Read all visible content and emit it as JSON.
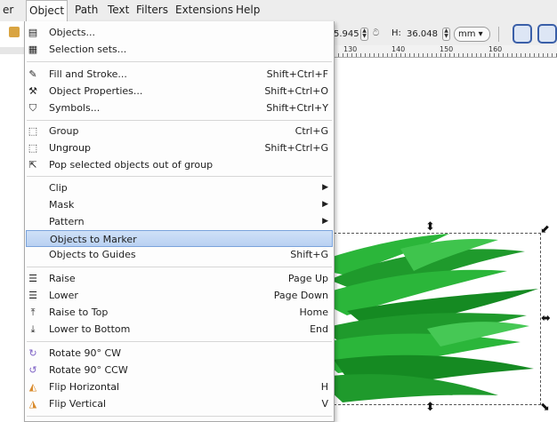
{
  "menubar": {
    "items": [
      {
        "label": "er"
      },
      {
        "label": "Object"
      },
      {
        "label": "Path"
      },
      {
        "label": "Text"
      },
      {
        "label": "Filters"
      },
      {
        "label": "Extensions"
      },
      {
        "label": "Help"
      }
    ]
  },
  "toolbar": {
    "x_value": "5.945",
    "h_label": "H:",
    "h_value": "36.048",
    "unit": "mm"
  },
  "ruler": {
    "labels": [
      "130",
      "140",
      "150",
      "160"
    ]
  },
  "menu": {
    "items": [
      {
        "label": "Objects...",
        "shortcut": "",
        "icon": "objects-icon"
      },
      {
        "label": "Selection sets...",
        "shortcut": "",
        "icon": "selection-sets-icon"
      },
      {
        "label": "Fill and Stroke...",
        "shortcut": "Shift+Ctrl+F",
        "icon": "fill-stroke-icon"
      },
      {
        "label": "Object Properties...",
        "shortcut": "Shift+Ctrl+O",
        "icon": "object-properties-icon"
      },
      {
        "label": "Symbols...",
        "shortcut": "Shift+Ctrl+Y",
        "icon": "symbols-icon"
      },
      {
        "label": "Group",
        "shortcut": "Ctrl+G",
        "icon": "group-icon"
      },
      {
        "label": "Ungroup",
        "shortcut": "Shift+Ctrl+G",
        "icon": "ungroup-icon"
      },
      {
        "label": "Pop selected objects out of group",
        "shortcut": "",
        "icon": "pop-out-icon"
      },
      {
        "label": "Clip",
        "shortcut": "",
        "icon": ""
      },
      {
        "label": "Mask",
        "shortcut": "",
        "icon": ""
      },
      {
        "label": "Pattern",
        "shortcut": "",
        "icon": ""
      },
      {
        "label": "Objects to Marker",
        "shortcut": "",
        "icon": ""
      },
      {
        "label": "Objects to Guides",
        "shortcut": "Shift+G",
        "icon": ""
      },
      {
        "label": "Raise",
        "shortcut": "Page Up",
        "icon": "raise-icon"
      },
      {
        "label": "Lower",
        "shortcut": "Page Down",
        "icon": "lower-icon"
      },
      {
        "label": "Raise to Top",
        "shortcut": "Home",
        "icon": "raise-top-icon"
      },
      {
        "label": "Lower to Bottom",
        "shortcut": "End",
        "icon": "lower-bottom-icon"
      },
      {
        "label": "Rotate 90° CW",
        "shortcut": "",
        "icon": "rotate-cw-icon"
      },
      {
        "label": "Rotate 90° CCW",
        "shortcut": "",
        "icon": "rotate-ccw-icon"
      },
      {
        "label": "Flip Horizontal",
        "shortcut": "H",
        "icon": "flip-horizontal-icon"
      },
      {
        "label": "Flip Vertical",
        "shortcut": "V",
        "icon": "flip-vertical-icon"
      }
    ],
    "highlighted": "Objects to Marker",
    "highlight_color": "#b9d1f2"
  },
  "canvas": {
    "object": "grass-shape",
    "colors": [
      "#1f9a2c",
      "#2bb63a",
      "#158a22"
    ]
  }
}
